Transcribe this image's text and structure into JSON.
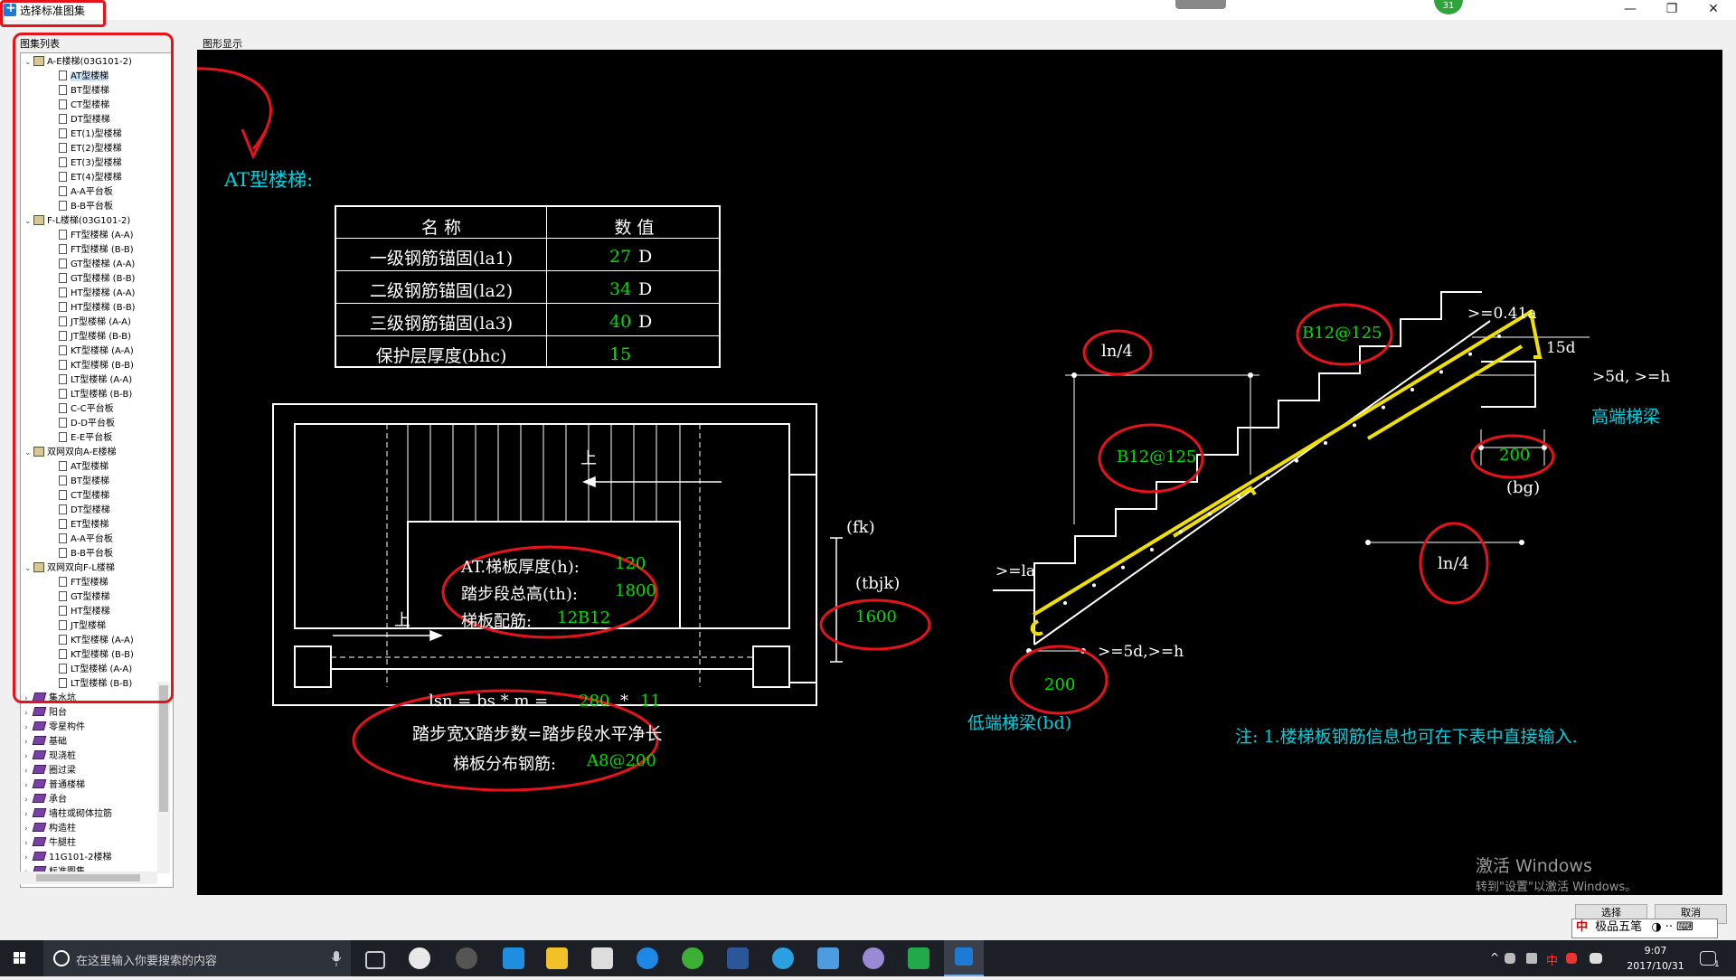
{
  "window": {
    "title": "选择标准图集"
  },
  "top_badge": "31",
  "window_controls": {
    "minimize": "—",
    "restore": "❐",
    "close": "✕"
  },
  "left_panel": {
    "label": "图集列表"
  },
  "right_panel": {
    "label": "图形显示"
  },
  "tree": [
    {
      "t": "group",
      "label": "A-E楼梯(03G101-2)",
      "open": true
    },
    {
      "t": "leaf",
      "label": "AT型楼梯",
      "selected": true
    },
    {
      "t": "leaf",
      "label": "BT型楼梯"
    },
    {
      "t": "leaf",
      "label": "CT型楼梯"
    },
    {
      "t": "leaf",
      "label": "DT型楼梯"
    },
    {
      "t": "leaf",
      "label": "ET(1)型楼梯"
    },
    {
      "t": "leaf",
      "label": "ET(2)型楼梯"
    },
    {
      "t": "leaf",
      "label": "ET(3)型楼梯"
    },
    {
      "t": "leaf",
      "label": "ET(4)型楼梯"
    },
    {
      "t": "leaf",
      "label": "A-A平台板"
    },
    {
      "t": "leaf",
      "label": "B-B平台板"
    },
    {
      "t": "group",
      "label": "F-L楼梯(03G101-2)",
      "open": true
    },
    {
      "t": "leaf",
      "label": "FT型楼梯 (A-A)"
    },
    {
      "t": "leaf",
      "label": "FT型楼梯 (B-B)"
    },
    {
      "t": "leaf",
      "label": "GT型楼梯 (A-A)"
    },
    {
      "t": "leaf",
      "label": "GT型楼梯 (B-B)"
    },
    {
      "t": "leaf",
      "label": "HT型楼梯 (A-A)"
    },
    {
      "t": "leaf",
      "label": "HT型楼梯 (B-B)"
    },
    {
      "t": "leaf",
      "label": "JT型楼梯 (A-A)"
    },
    {
      "t": "leaf",
      "label": "JT型楼梯 (B-B)"
    },
    {
      "t": "leaf",
      "label": "KT型楼梯 (A-A)"
    },
    {
      "t": "leaf",
      "label": "KT型楼梯 (B-B)"
    },
    {
      "t": "leaf",
      "label": "LT型楼梯 (A-A)"
    },
    {
      "t": "leaf",
      "label": "LT型楼梯 (B-B)"
    },
    {
      "t": "leaf",
      "label": "C-C平台板"
    },
    {
      "t": "leaf",
      "label": "D-D平台板"
    },
    {
      "t": "leaf",
      "label": "E-E平台板"
    },
    {
      "t": "group",
      "label": "双网双向A-E楼梯",
      "open": true
    },
    {
      "t": "leaf",
      "label": "AT型楼梯"
    },
    {
      "t": "leaf",
      "label": "BT型楼梯"
    },
    {
      "t": "leaf",
      "label": "CT型楼梯"
    },
    {
      "t": "leaf",
      "label": "DT型楼梯"
    },
    {
      "t": "leaf",
      "label": "ET型楼梯"
    },
    {
      "t": "leaf",
      "label": "A-A平台板"
    },
    {
      "t": "leaf",
      "label": "B-B平台板"
    },
    {
      "t": "group",
      "label": "双网双向F-L楼梯",
      "open": true
    },
    {
      "t": "leaf",
      "label": "FT型楼梯"
    },
    {
      "t": "leaf",
      "label": "GT型楼梯"
    },
    {
      "t": "leaf",
      "label": "HT型楼梯"
    },
    {
      "t": "leaf",
      "label": "JT型楼梯"
    },
    {
      "t": "leaf",
      "label": "KT型楼梯 (A-A)"
    },
    {
      "t": "leaf",
      "label": "KT型楼梯 (B-B)"
    },
    {
      "t": "leaf",
      "label": "LT型楼梯 (A-A)"
    },
    {
      "t": "leaf",
      "label": "LT型楼梯 (B-B)"
    },
    {
      "t": "root",
      "label": "集水坑"
    },
    {
      "t": "root",
      "label": "阳台"
    },
    {
      "t": "root",
      "label": "零星构件"
    },
    {
      "t": "root",
      "label": "基础"
    },
    {
      "t": "root",
      "label": "现浇桩"
    },
    {
      "t": "root",
      "label": "圈过梁"
    },
    {
      "t": "root",
      "label": "普通楼梯"
    },
    {
      "t": "root",
      "label": "承台"
    },
    {
      "t": "root",
      "label": "墙柱或砌体拉筋"
    },
    {
      "t": "root",
      "label": "构造柱"
    },
    {
      "t": "root",
      "label": "牛腿柱"
    },
    {
      "t": "root",
      "label": "11G101-2楼梯"
    },
    {
      "t": "root",
      "label": "标准图集"
    }
  ],
  "drawing": {
    "heading": "AT型楼梯:",
    "table": {
      "header_name": "名 称",
      "header_value": "数 值",
      "rows": [
        {
          "name": "一级钢筋锚固(la1)",
          "value": "27",
          "unit": "D"
        },
        {
          "name": "二级钢筋锚固(la2)",
          "value": "34",
          "unit": "D"
        },
        {
          "name": "三级钢筋锚固(la3)",
          "value": "40",
          "unit": "D"
        },
        {
          "name": "保护层厚度(bhc)",
          "value": "15",
          "unit": ""
        }
      ]
    },
    "plan": {
      "up_label": "上",
      "up_label2": "上",
      "thickness_label": "AT.梯板厚度(h):",
      "thickness_value": "120",
      "height_label": "踏步段总高(th):",
      "height_value": "1800",
      "rebar_label": "梯板配筋:",
      "rebar_value": "12B12",
      "fk": "(fk)",
      "tbjk": "(tbjk)",
      "tbjk_value": "1600",
      "formula_prefix": "lsn = bs * m =",
      "formula_bs": "280",
      "formula_star": "*",
      "formula_m": "11",
      "formula_line2": "踏步宽X踏步数=踏步段水平净长",
      "dist_label": "梯板分布钢筋:",
      "dist_value": "A8@200"
    },
    "section": {
      "ln4_left": "ln/4",
      "ln4_right": "ln/4",
      "b12_top": "B12@125",
      "b12_mid": "B12@125",
      "anchor_041": ">=0.41a",
      "d15": "15d",
      "d5h_top": ">5d, >=h",
      "high_beam": "高端梯梁",
      "bg_value": "200",
      "bg_label": "(bg)",
      "la_label": ">=la",
      "d5h_bottom": ">=5d,>=h",
      "bd_value": "200",
      "low_beam": "低端梯梁(bd)"
    },
    "note": "注: 1.楼梯板钢筋信息也可在下表中直接输入."
  },
  "watermark": {
    "line1": "激活 Windows",
    "line2": "转到\"设置\"以激活 Windows。"
  },
  "buttons": {
    "select": "选择",
    "cancel": "取消"
  },
  "ime": {
    "brand": "中",
    "name": "极品五笔",
    "symbols": "◑ ·· ⌨"
  },
  "taskbar": {
    "search_placeholder": "在这里输入你要搜索的内容",
    "time": "9:07",
    "date": "2017/10/31",
    "ime_short": "中",
    "notify_count": "1"
  },
  "colors": {
    "label_green": "#00e000",
    "label_cyan": "#00d0e0",
    "rebar_yellow": "#f0e000",
    "annotation_red": "#e8121b"
  }
}
